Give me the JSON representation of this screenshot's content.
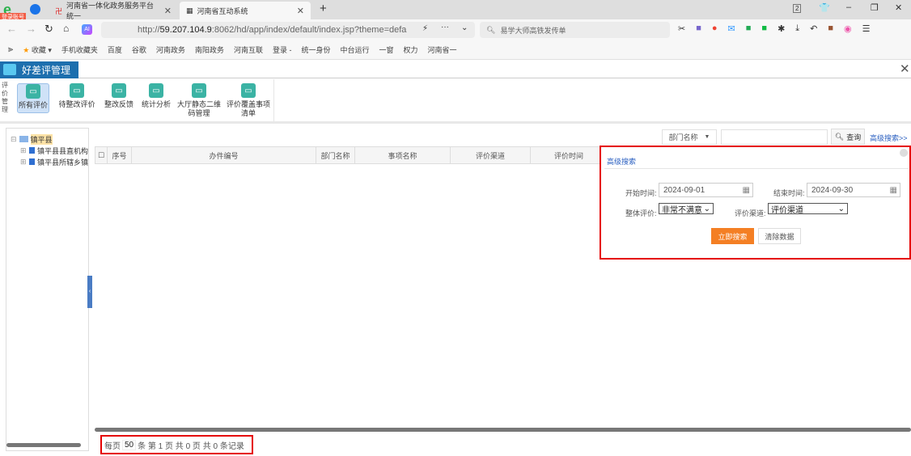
{
  "browser": {
    "badge": "登录账号",
    "tabs": [
      {
        "title": "河南省一体化政务服务平台统一"
      },
      {
        "title": "河南省互动系统"
      }
    ],
    "url_prefix": "http://",
    "url_host": "59.207.104.9",
    "url_rest": ":8062/hd/app/index/default/index.jsp?theme=defa",
    "search_placeholder": "易学大师高铁发传单",
    "tab_count": "2",
    "bookmarks": [
      "收藏",
      "手机收藏夹",
      "百度",
      "谷歌",
      "河南政务",
      "南阳政务",
      "河南互联",
      "登录 -",
      "统一身份",
      "中台运行",
      "一窗",
      "权力",
      "河南省一"
    ]
  },
  "app": {
    "title": "好差评管理",
    "side_label": "评价管理",
    "toolbar": [
      {
        "label": "所有评价",
        "selected": true
      },
      {
        "label": "待整改评价"
      },
      {
        "label": "整改反馈"
      },
      {
        "label": "统计分析"
      },
      {
        "label": "大厅静态二维码管理"
      },
      {
        "label": "评价覆盖事项清单"
      }
    ],
    "tree": {
      "root": "镇平县",
      "children": [
        "镇平县县直机构",
        "镇平县所辖乡镇"
      ]
    },
    "search": {
      "dept_select": "部门名称",
      "query_button": "查询",
      "advanced_link": "高级搜索>>"
    },
    "grid": {
      "columns": [
        "序号",
        "办件编号",
        "部门名称",
        "事项名称",
        "评价渠道",
        "评价时间"
      ]
    },
    "advanced": {
      "title": "高级搜索",
      "start_label": "开始时间:",
      "start_value": "2024-09-01",
      "end_label": "结束时间:",
      "end_value": "2024-09-30",
      "overall_label": "整体评价:",
      "overall_value": "非常不满意",
      "channel_label": "评价渠道:",
      "channel_value": "评价渠道",
      "search_button": "立即搜索",
      "clear_button": "清除数据",
      "accent": "#f47f24",
      "highlight": "#e50000"
    },
    "pager": {
      "per_page_label": "每页",
      "per_page": "50",
      "rest": "条 第 1 页 共 0 页 共 0 条记录"
    }
  }
}
